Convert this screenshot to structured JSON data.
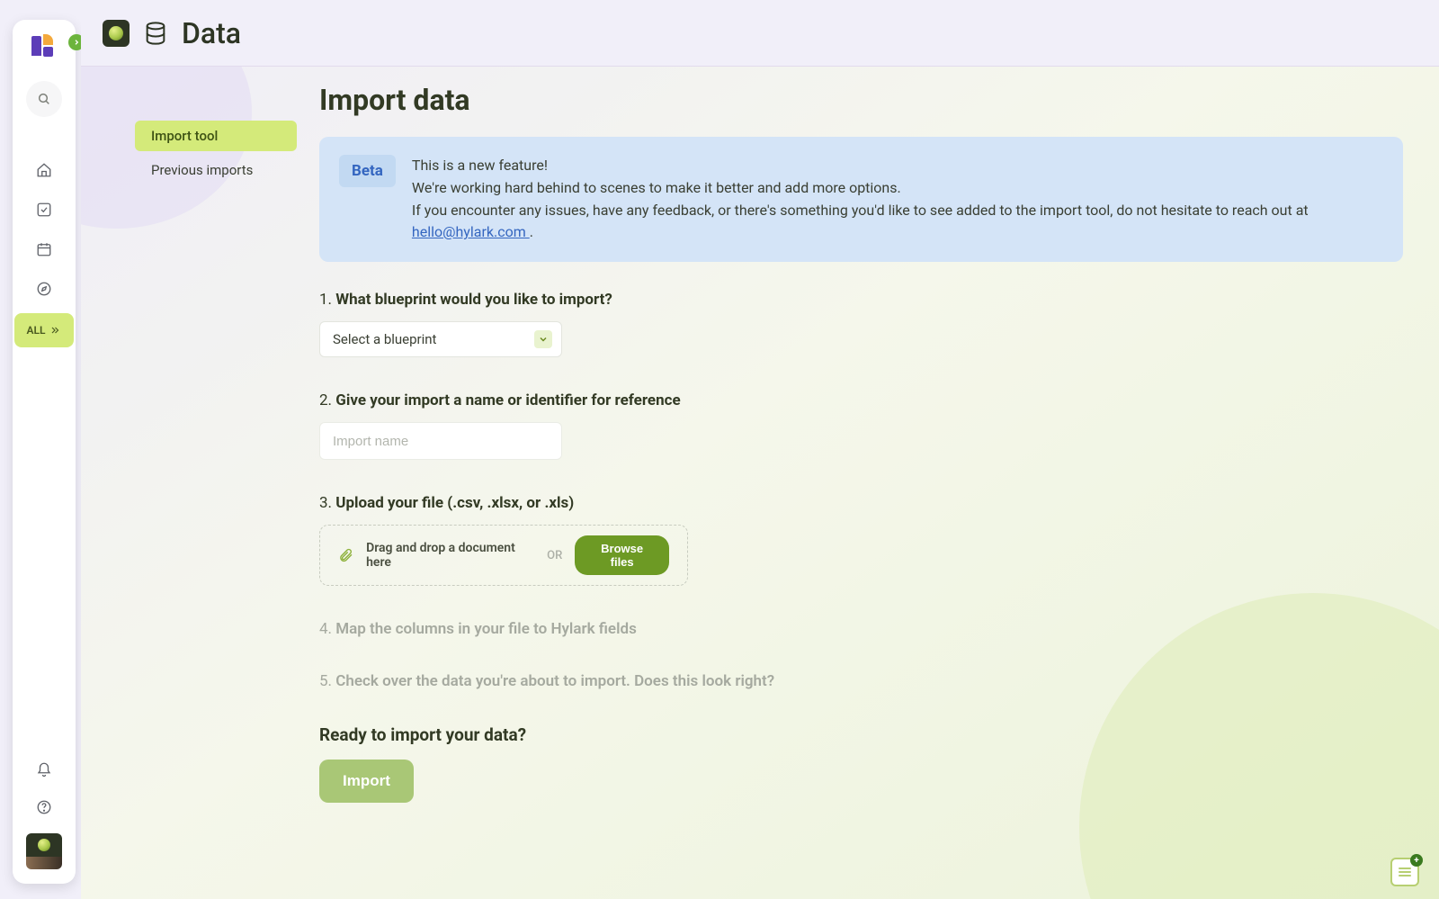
{
  "header": {
    "title": "Data"
  },
  "sidebar": {
    "all_label": "ALL"
  },
  "tabs": {
    "import_tool": "Import tool",
    "previous_imports": "Previous imports"
  },
  "page": {
    "title": "Import data"
  },
  "beta": {
    "badge": "Beta",
    "line1": "This is a new feature!",
    "line2": "We're working hard behind to scenes to make it better and add more options.",
    "line3_prefix": "If you encounter any issues, have any feedback, or there's something you'd like to see added to the import tool, do not hesitate to reach out at ",
    "email": "hello@hylark.com ",
    "line3_suffix": "."
  },
  "steps": {
    "s1_num": "1. ",
    "s1_text": "What blueprint would you like to import?",
    "select_placeholder": "Select a blueprint",
    "s2_num": "2. ",
    "s2_text": "Give your import a name or identifier for reference",
    "name_placeholder": "Import name",
    "s3_num": "3. ",
    "s3_text": "Upload your file (.csv, .xlsx, or .xls)",
    "drag_text": "Drag and drop a document here",
    "or_label": "OR",
    "browse_label": "Browse files",
    "s4_num": "4. ",
    "s4_text": "Map the columns in your file to Hylark fields",
    "s5_num": "5. ",
    "s5_text": "Check over the data you're about to import. Does this look right?"
  },
  "ready": {
    "title": "Ready to import your data?",
    "button": "Import"
  }
}
